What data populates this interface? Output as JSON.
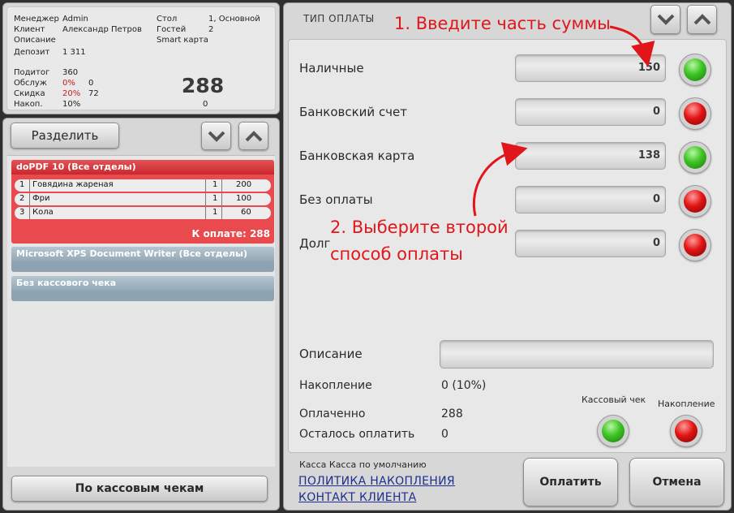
{
  "info": {
    "manager_label": "Менеджер",
    "manager_value": "Admin",
    "client_label": "Клиент",
    "client_value": "Александр Петров",
    "description_label": "Описание",
    "deposit_label": "Депозит",
    "deposit_value": "1 311",
    "table_label": "Стол",
    "table_value": "1, Основной",
    "guests_label": "Гостей",
    "guests_value": "2",
    "card_value": "Smart карта",
    "subtotal_label": "Подитог",
    "subtotal_value": "360",
    "service_label": "Обслуж",
    "service_pct": "0%",
    "service_value": "0",
    "discount_label": "Скидка",
    "discount_pct": "20%",
    "discount_value": "72",
    "accum_label": "Накоп.",
    "accum_pct": "10%",
    "accum_value": "0",
    "total": "288"
  },
  "checks": {
    "split_label": "Разделить",
    "printer1": "doPDF 10 (Все отделы)",
    "items": [
      {
        "n": "1",
        "name": "Говядина жареная",
        "qty": "1",
        "price": "200"
      },
      {
        "n": "2",
        "name": "Фри",
        "qty": "1",
        "price": "100"
      },
      {
        "n": "3",
        "name": "Кола",
        "qty": "1",
        "price": "60"
      }
    ],
    "to_pay": "К оплате: 288",
    "printer2": "Microsoft XPS Document Writer (Все отделы)",
    "printer3": "Без кассового чека",
    "by_receipts_label": "По кассовым чекам"
  },
  "payment": {
    "title": "ТИП ОПЛАТЫ",
    "methods": [
      {
        "label": "Наличные",
        "amount": "150",
        "lamp": "green"
      },
      {
        "label": "Банковский счет",
        "amount": "0",
        "lamp": "red"
      },
      {
        "label": "Банковская карта",
        "amount": "138",
        "lamp": "green"
      },
      {
        "label": "Без оплаты",
        "amount": "0",
        "lamp": "red"
      },
      {
        "label": "Долг",
        "amount": "0",
        "lamp": "red"
      }
    ],
    "description_label": "Описание",
    "accumulation_label": "Накопление",
    "accumulation_value": "0 (10%)",
    "paid_label": "Оплаченно",
    "paid_value": "288",
    "remaining_label": "Осталось оплатить",
    "remaining_value": "0",
    "receipt_toggle_label": "Кассовый чек",
    "receipt_toggle": "green",
    "accum_toggle_label": "Накопление",
    "accum_toggle": "red",
    "cash_register_text": "Касса  Касса по умолчанию",
    "link_policy": "ПОЛИТИКА НАКОПЛЕНИЯ",
    "link_contact": "КОНТАКТ КЛИЕНТА",
    "pay_button": "Оплатить",
    "cancel_button": "Отмена"
  },
  "hints": {
    "hint1": "1. Введите часть суммы",
    "hint2_line1": "2. Выберите второй",
    "hint2_line2": "способ оплаты"
  },
  "colors": {
    "accent_red": "#e0161a",
    "check_red": "#e84a4e",
    "lamp_green": "#3cc423",
    "lamp_red": "#e21414"
  }
}
